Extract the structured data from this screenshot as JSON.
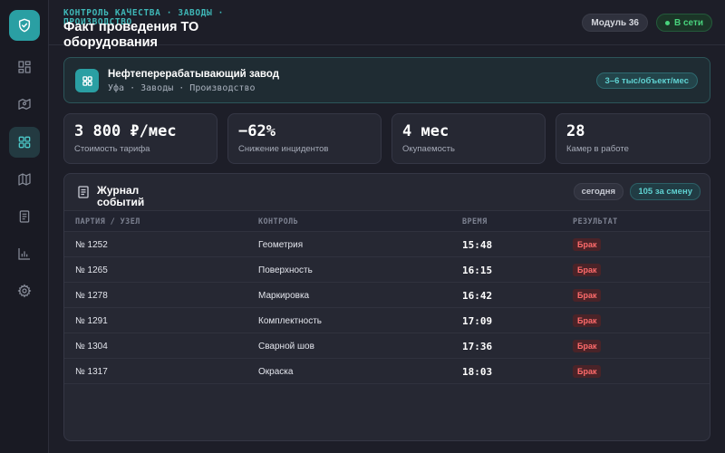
{
  "sidebar": {
    "items": [
      {
        "name": "dashboard",
        "icon": "dashboard-icon",
        "active": false
      },
      {
        "name": "map",
        "icon": "map-pin-icon",
        "active": false
      },
      {
        "name": "grid",
        "icon": "grid-icon",
        "active": true
      },
      {
        "name": "map-folded",
        "icon": "map-icon",
        "active": false
      },
      {
        "name": "documents",
        "icon": "document-icon",
        "active": false
      },
      {
        "name": "analytics",
        "icon": "bar-chart-icon",
        "active": false
      },
      {
        "name": "settings",
        "icon": "gear-icon",
        "active": false
      }
    ]
  },
  "header": {
    "breadcrumb": "Контроль качества · Заводы · Производство",
    "title": "Факт проведения ТО оборудования",
    "module_label": "Модуль 36",
    "status_label": "В сети"
  },
  "facility": {
    "name": "Нефтеперерабатывающий завод",
    "subtitle": "Уфа · Заводы · Производство",
    "price_badge": "3–6 тыс/объект/мес"
  },
  "stats": [
    {
      "value": "3 800 ₽/мес",
      "label": "Стоимость тарифа"
    },
    {
      "value": "−62%",
      "label": "Снижение инцидентов"
    },
    {
      "value": "4 мес",
      "label": "Окупаемость"
    },
    {
      "value": "28",
      "label": "Камер в работе"
    }
  ],
  "journal": {
    "title": "Журнал событий",
    "filter_today": "сегодня",
    "shift_count": "105 за смену",
    "columns": [
      "ПАРТИЯ / УЗЕЛ",
      "КОНТРОЛЬ",
      "ВРЕМЯ",
      "РЕЗУЛЬТАТ"
    ],
    "rows": [
      {
        "batch": "№ 1252",
        "control": "Геометрия",
        "time": "15:48",
        "result": "Брак"
      },
      {
        "batch": "№ 1265",
        "control": "Поверхность",
        "time": "16:15",
        "result": "Брак"
      },
      {
        "batch": "№ 1278",
        "control": "Маркировка",
        "time": "16:42",
        "result": "Брак"
      },
      {
        "batch": "№ 1291",
        "control": "Комплектность",
        "time": "17:09",
        "result": "Брак"
      },
      {
        "batch": "№ 1304",
        "control": "Сварной шов",
        "time": "17:36",
        "result": "Брак"
      },
      {
        "batch": "№ 1317",
        "control": "Окраска",
        "time": "18:03",
        "result": "Брак"
      }
    ]
  },
  "colors": {
    "accent": "#2a9fa3",
    "online": "#49d37d",
    "defect": "#ff6b6b",
    "background": "#1d1e28"
  }
}
